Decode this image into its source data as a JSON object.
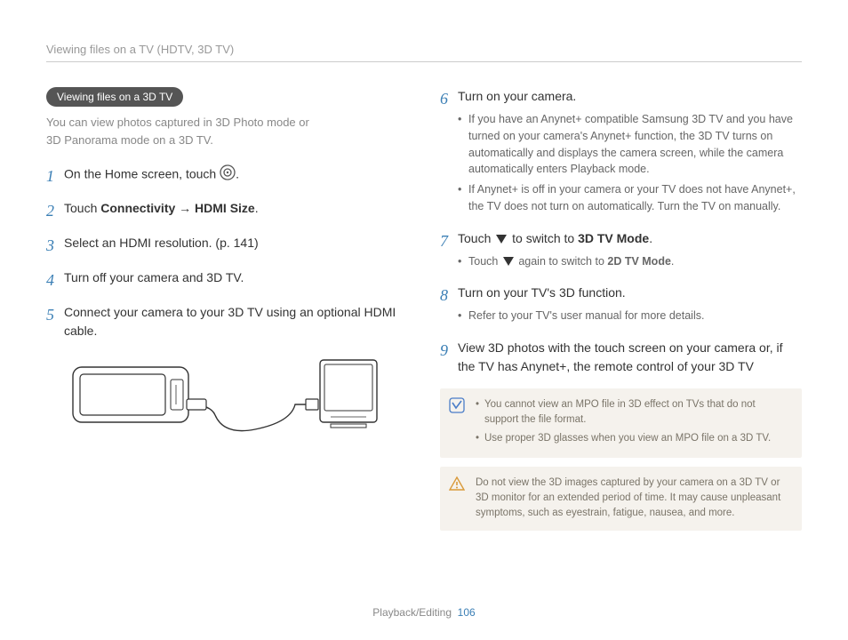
{
  "header": "Viewing files on a TV (HDTV, 3D TV)",
  "pill": "Viewing files on a 3D TV",
  "intro_l1": "You can view photos captured in 3D Photo mode or",
  "intro_l2": "3D Panorama mode on a 3D TV.",
  "left_steps": {
    "s1": "On the Home screen, touch ",
    "s2_a": "Touch ",
    "s2_b": "Connectivity",
    "s2_c": " → ",
    "s2_d": "HDMI Size",
    "s2_e": ".",
    "s3": "Select an HDMI resolution. (p. 141)",
    "s4": "Turn off your camera and 3D TV.",
    "s5": "Connect your camera to your 3D TV using an optional HDMI cable."
  },
  "right_steps": {
    "s6": "Turn on your camera.",
    "s6_b1": "If you have an Anynet+ compatible Samsung 3D TV and you have turned on your camera's Anynet+ function, the 3D TV turns on automatically and displays the camera screen, while the camera automatically enters Playback mode.",
    "s6_b2": "If Anynet+ is off in your camera or your TV does not have Anynet+, the TV does not turn on automatically. Turn the TV on manually.",
    "s7_a": "Touch ",
    "s7_b": " to switch to ",
    "s7_c": "3D TV Mode",
    "s7_d": ".",
    "s7_sub_a": "Touch ",
    "s7_sub_b": " again to switch to ",
    "s7_sub_c": "2D TV Mode",
    "s7_sub_d": ".",
    "s8": "Turn on your TV's 3D function.",
    "s8_b1": "Refer to your TV's user manual for more details.",
    "s9": "View 3D photos with the touch screen on your camera or, if the TV has Anynet+, the remote control of your 3D TV"
  },
  "note": {
    "n1": "You cannot view an MPO file in 3D effect on TVs that do not support the file format.",
    "n2": "Use proper 3D glasses when you view an MPO file on a 3D TV."
  },
  "warn": "Do not view the 3D images captured by your camera on a 3D TV or 3D monitor for an extended period of time. It may cause unpleasant symptoms, such as eyestrain, fatigue, nausea, and more.",
  "footer_section": "Playback/Editing",
  "footer_page": "106"
}
